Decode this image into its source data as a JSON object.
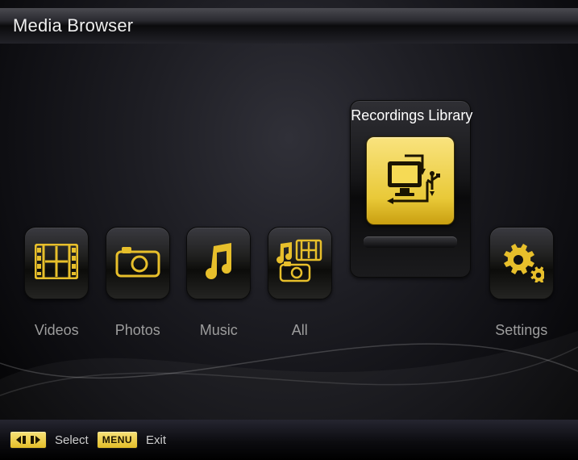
{
  "header": {
    "title": "Media Browser"
  },
  "tiles": [
    {
      "label": "Videos",
      "icon": "film",
      "selected": false
    },
    {
      "label": "Photos",
      "icon": "camera",
      "selected": false
    },
    {
      "label": "Music",
      "icon": "music-note",
      "selected": false
    },
    {
      "label": "All",
      "icon": "all-media",
      "selected": false
    },
    {
      "label": "Recordings Library",
      "icon": "recordings",
      "selected": true
    },
    {
      "label": "Settings",
      "icon": "gears",
      "selected": false
    }
  ],
  "footer": {
    "select_label": "Select",
    "exit_label": "Exit",
    "menu_key": "MENU"
  },
  "colors": {
    "gold": "#e7bf2b",
    "gold_light": "#f8e27a",
    "gold_dark": "#c99f10"
  }
}
